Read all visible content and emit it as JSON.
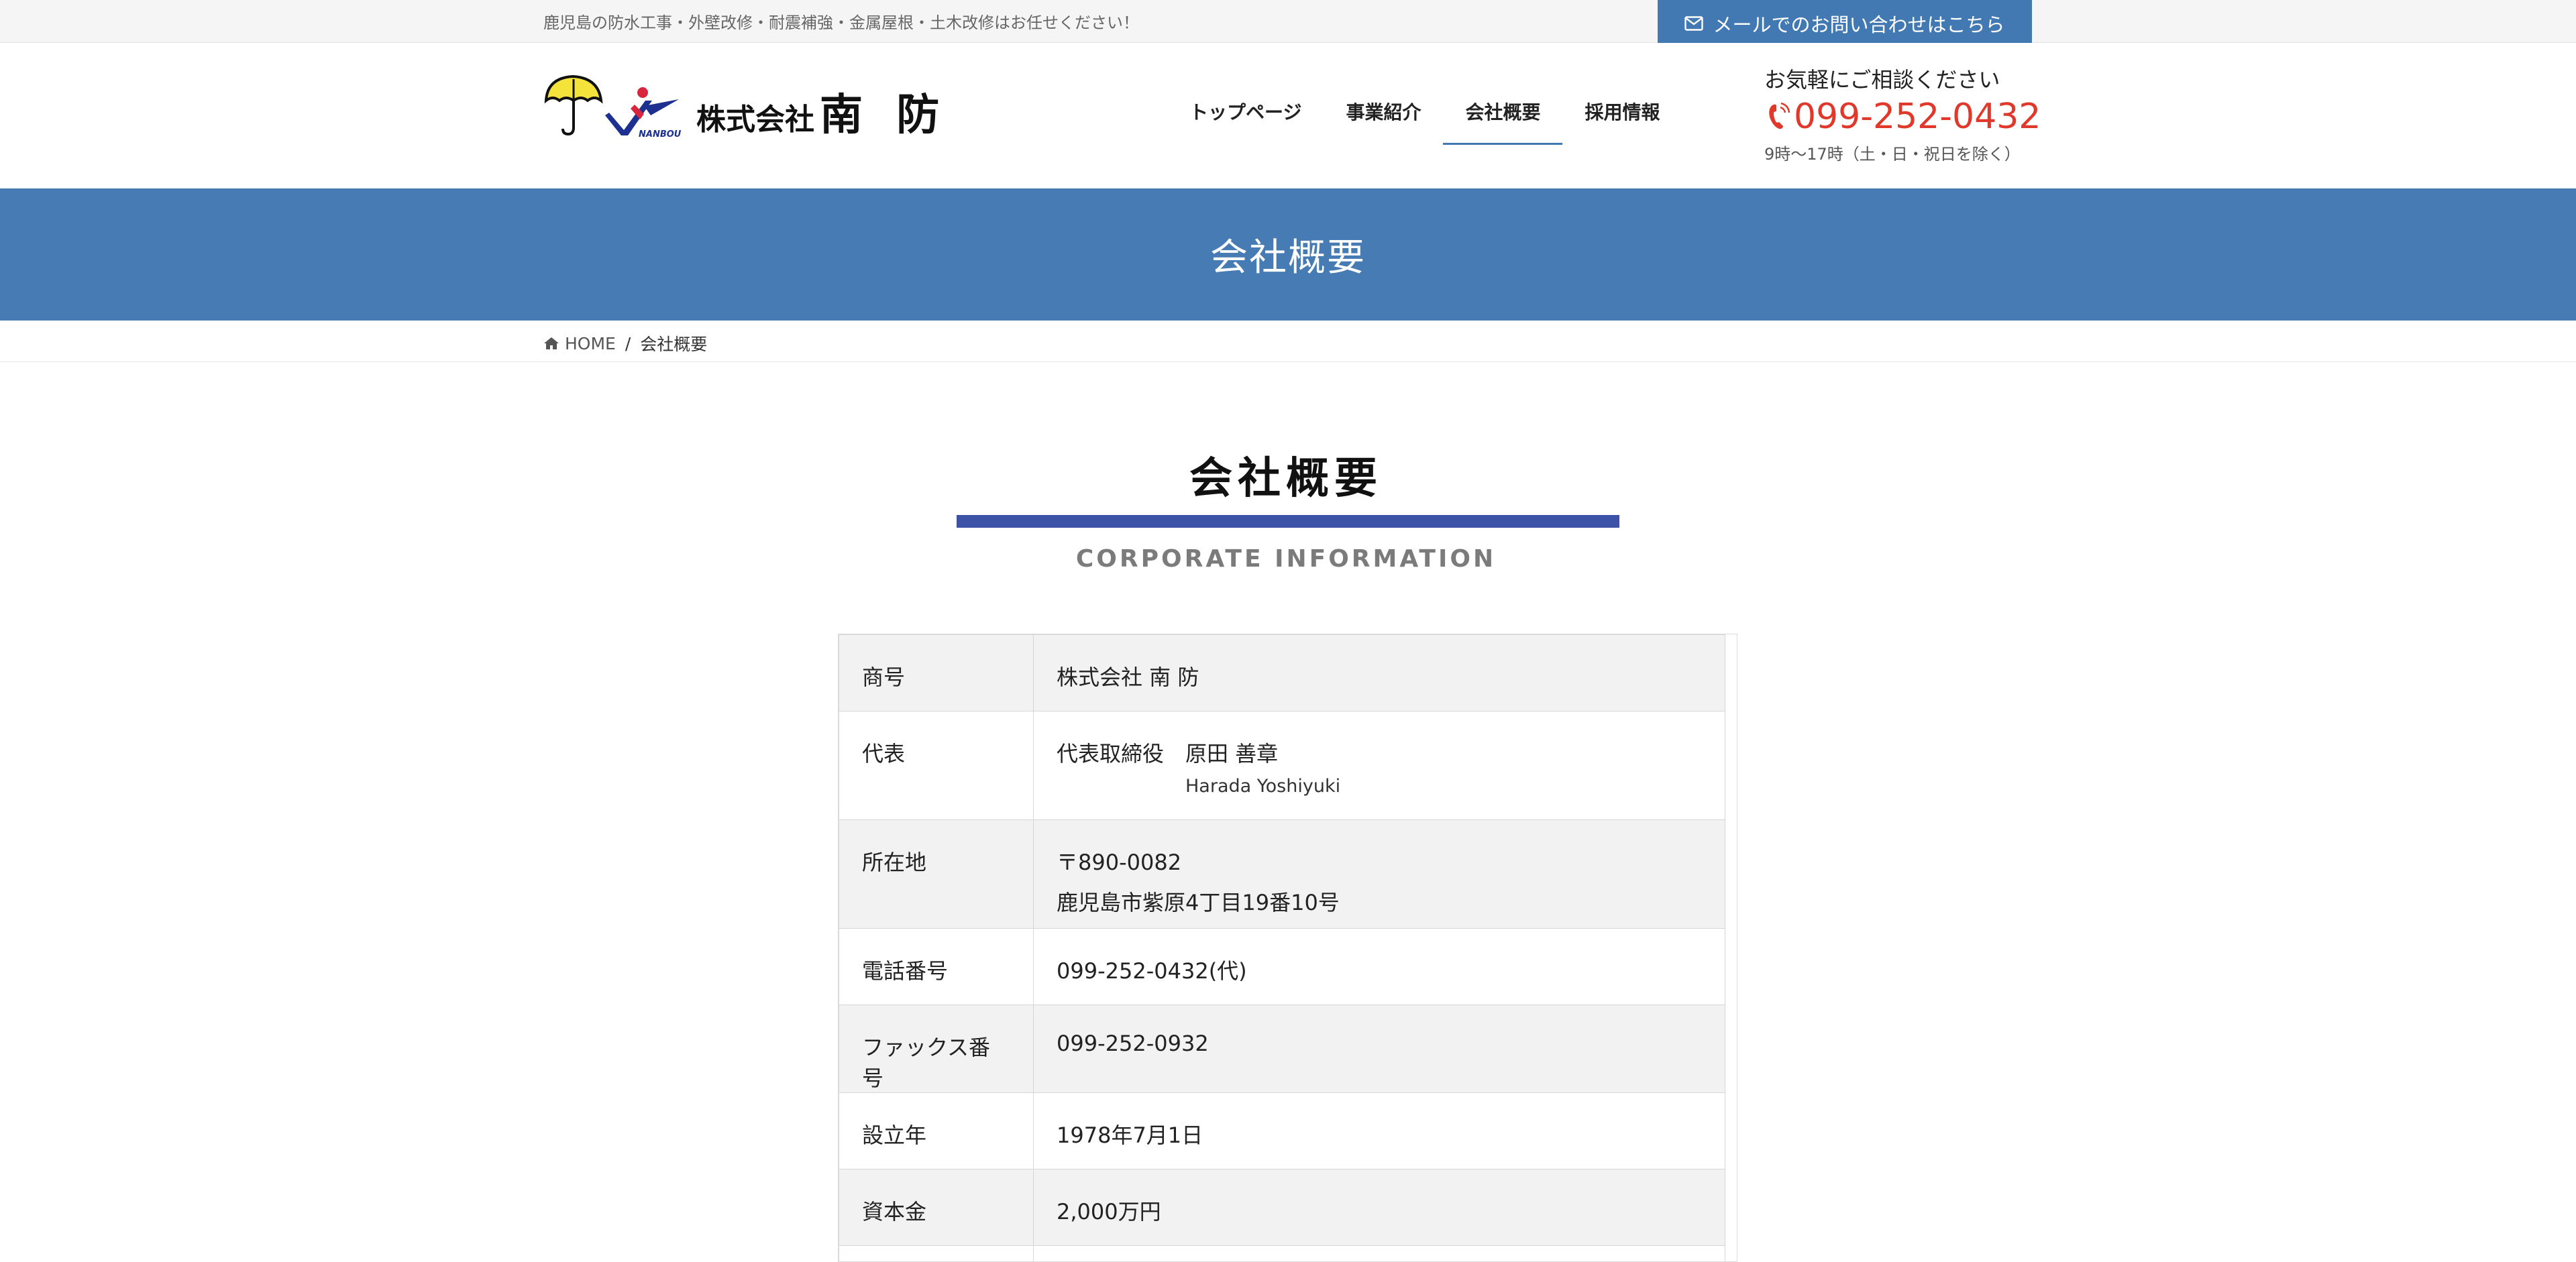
{
  "topbar": {
    "tagline": "鹿児島の防水工事・外壁改修・耐震補強・金属屋根・土木改修はお任せください！",
    "contact_button": "メールでのお問い合わせはこちら"
  },
  "logo": {
    "prefix": "株式会社",
    "name": "南 防",
    "mark_text": "NANBOU"
  },
  "nav": {
    "items": [
      {
        "label": "トップページ"
      },
      {
        "label": "事業紹介"
      },
      {
        "label": "会社概要"
      },
      {
        "label": "採用情報"
      }
    ],
    "active": "会社概要"
  },
  "tel": {
    "lead": "お気軽にご相談ください",
    "number": "099-252-0432",
    "hours": "9時〜17時（土・日・祝日を除く）"
  },
  "page_title": "会社概要",
  "breadcrumb": {
    "home": "HOME",
    "separator": "/",
    "current": "会社概要"
  },
  "section": {
    "title": "会社概要",
    "subtitle": "CORPORATE INFORMATION"
  },
  "info": {
    "rows": [
      {
        "label": "商号",
        "value": "株式会社 南 防"
      },
      {
        "label": "代表",
        "value": "代表取締役　原田 善章",
        "sub": "Harada Yoshiyuki"
      },
      {
        "label": "所在地",
        "value": "〒890-0082",
        "value2": "鹿児島市紫原4丁目19番10号"
      },
      {
        "label": "電話番号",
        "value": "099-252-0432(代)"
      },
      {
        "label": "ファックス番号",
        "value": "099-252-0932"
      },
      {
        "label": "設立年",
        "value": "1978年7月1日"
      },
      {
        "label": "資本金",
        "value": "2,000万円"
      },
      {
        "label": "",
        "value": ""
      }
    ]
  },
  "colors": {
    "accent_blue": "#4279b2",
    "title_band": "#477bb3",
    "heading_bar": "#3c52a6",
    "phone_red": "#e0382b",
    "umbrella_yellow": "#f3e33b"
  },
  "icons": {
    "contact": "envelope-icon",
    "phone": "phone-icon",
    "home": "home-icon"
  }
}
